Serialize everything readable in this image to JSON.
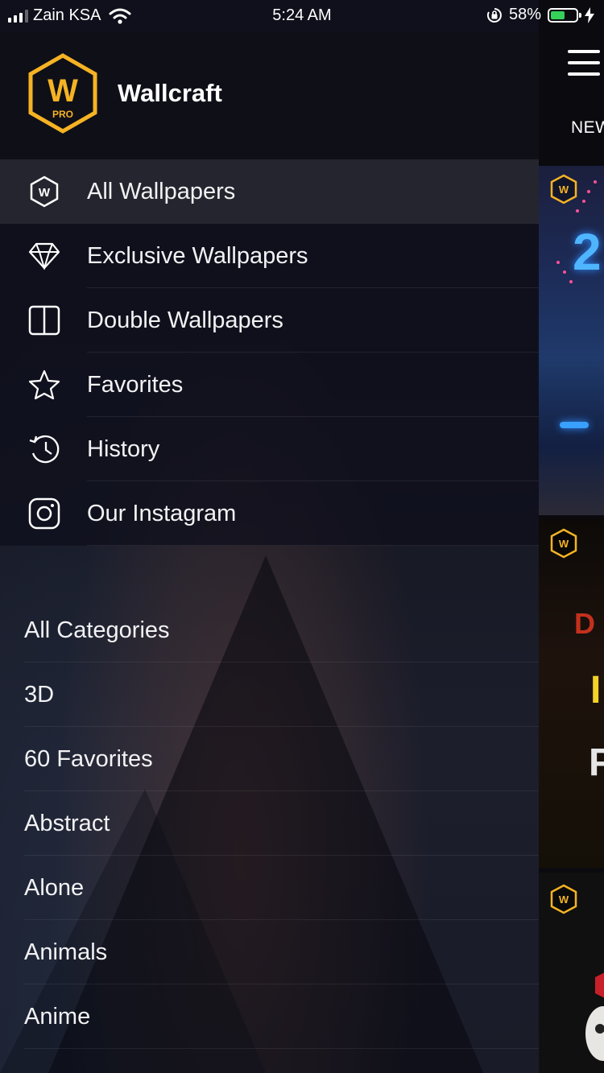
{
  "status_bar": {
    "carrier": "Zain KSA",
    "time": "5:24 AM",
    "battery_percent": "58%",
    "battery_level": 0.58,
    "battery_color": "#35d158"
  },
  "drawer": {
    "logo_letter": "W",
    "logo_badge": "PRO",
    "logo_color": "#f5b324",
    "app_title": "Wallcraft",
    "menu": [
      {
        "label": "All Wallpapers",
        "icon": "w-hex-icon",
        "active": true
      },
      {
        "label": "Exclusive Wallpapers",
        "icon": "diamond-icon"
      },
      {
        "label": "Double Wallpapers",
        "icon": "split-screen-icon"
      },
      {
        "label": "Favorites",
        "icon": "star-icon"
      },
      {
        "label": "History",
        "icon": "history-icon"
      },
      {
        "label": "Our Instagram",
        "icon": "instagram-icon"
      }
    ],
    "categories": [
      "All Categories",
      "3D",
      "60 Favorites",
      "Abstract",
      "Alone",
      "Animals",
      "Anime"
    ]
  },
  "main": {
    "tab_partial": "NEW",
    "menu_icon": "hamburger-icon",
    "thumb_badge": "W"
  }
}
